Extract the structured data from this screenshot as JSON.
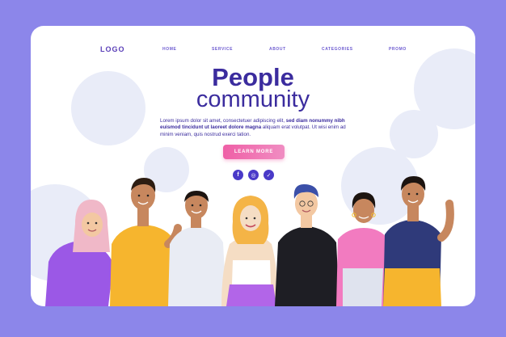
{
  "nav": {
    "logo": "LOGO",
    "items": [
      {
        "label": "HOME"
      },
      {
        "label": "SERVICE"
      },
      {
        "label": "ABOUT"
      },
      {
        "label": "CATEGORIES"
      },
      {
        "label": "PROMO"
      }
    ]
  },
  "hero": {
    "title_line1": "People",
    "title_line2": "community",
    "description_part1": "Lorem ipsum dolor sit amet, consectetuer adipiscing elit, ",
    "description_bold1": "sed diam nonummy",
    "description_bold2": "nibh euismod tincidunt ut laoreet dolore magna",
    "description_part2": " aliquam erat volutpat. Ut wisi",
    "description_part3": "enim ad minim veniam, quis nostrud exerci tation.",
    "cta_label": "LEARN MORE"
  },
  "social": [
    {
      "icon": "facebook-icon",
      "glyph": "f"
    },
    {
      "icon": "instagram-icon",
      "glyph": "◎"
    },
    {
      "icon": "twitter-icon",
      "glyph": "✓"
    }
  ],
  "colors": {
    "background": "#8c86ea",
    "accent": "#3b2c9e",
    "cta": "#ef5fa6"
  }
}
